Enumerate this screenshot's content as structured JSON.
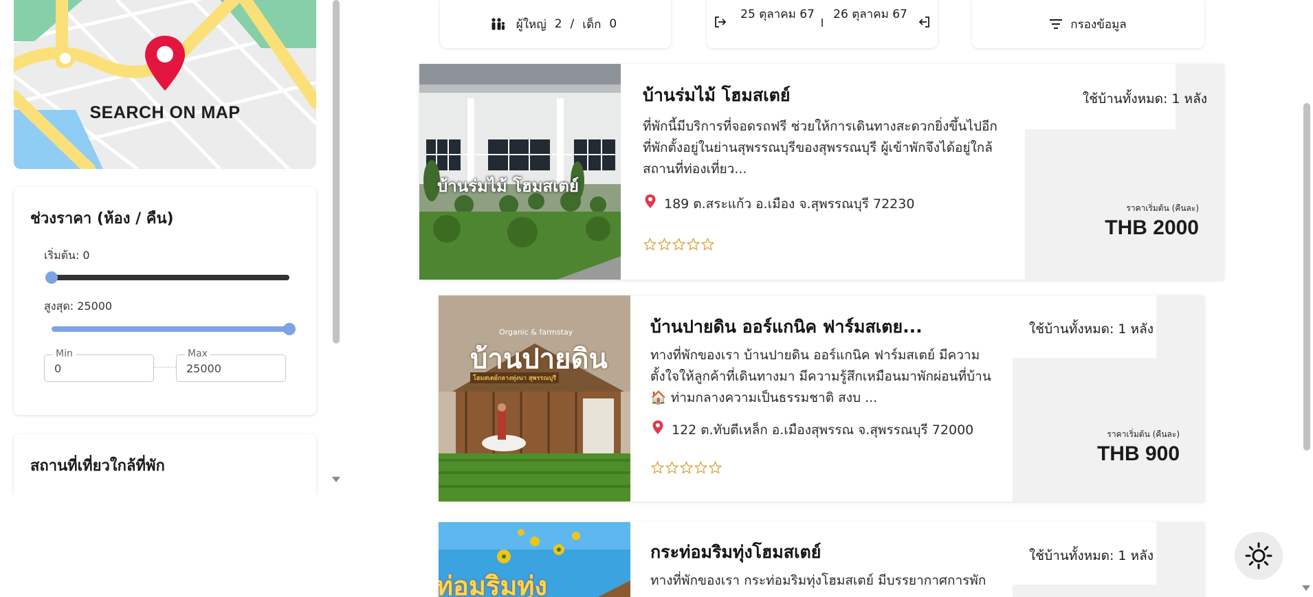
{
  "map": {
    "label": "SEARCH ON MAP",
    "icon": "map-pin-icon"
  },
  "price_filter": {
    "title": "ช่วงราคา (ห้อง / คืน)",
    "start_label": "เริ่มต้น: 0",
    "max_label": "สูงสุด: 25000",
    "min_slider_fraction": 0.0,
    "max_slider_fraction": 1.0,
    "min_field": {
      "legend": "Min",
      "value": "0"
    },
    "max_field": {
      "legend": "Max",
      "value": "25000"
    }
  },
  "nearby": {
    "title": "สถานที่เที่ยวใกล้ที่พัก"
  },
  "search_bar": {
    "guests": {
      "adults_label": "ผู้ใหญ่",
      "adults": "2",
      "separator": "/",
      "children_label": "เด็ก",
      "children": "0"
    },
    "dates": {
      "checkin": "25 ตุลาคม 67",
      "checkout": "26 ตุลาคม 67"
    },
    "filter_label": "กรองข้อมูล"
  },
  "listings": [
    {
      "title": "บ้านร่มไม้ โฮมสเตย์",
      "description": "ที่พักนี้มีบริการที่จอดรถฟรี ช่วยให้การเดินทางสะดวกยิ่งขึ้นไปอีก ที่พักตั้งอยู่ในย่านสุพรรณบุรีของสุพรรณบุรี ผู้เข้าพักจึงได้อยู่ใกล้สถานที่ท่องเที่ยว...",
      "address": "189 ต.สระแก้ว อ.เมือง จ.สุพรรณบุรี 72230",
      "capacity": "ใช้บ้านทั้งหมด: 1 หลัง",
      "price_label": "ราคาเริ่มต้น (คืนละ)",
      "price": "THB 2000",
      "rating": 0,
      "sign_text": "บ้านร่มไม้ โฮมสเตย์"
    },
    {
      "title": "บ้านปายดิน ออร์แกนิค ฟาร์มสเตย...",
      "description": "ทางที่พักของเรา บ้านปายดิน ออร์แกนิค ฟาร์มสเตย์ มีความตั้งใจให้ลูกค้าที่เดินทางมา มีความรู้สึกเหมือนมาพักผ่อนที่บ้าน 🏠 ท่ามกลางความเป็นธรรมชาติ สงบ ...",
      "address": "122 ต.ทับตีเหล็ก อ.เมืองสุพรรณ จ.สุพรรณบุรี 72000",
      "capacity": "ใช้บ้านทั้งหมด: 1 หลัง",
      "price_label": "ราคาเริ่มต้น (คืนละ)",
      "price": "THB 900",
      "rating": 0,
      "sign_small": "Organic & farmstay",
      "sign_big": "บ้านปายดิน",
      "sign_sub": "โฮมสเตย์กลางทุ่งนา สุพรรณบุรี"
    },
    {
      "title": "กระท่อมริมทุ่งโฮมสเตย์",
      "description": "ทางที่พักของเรา กระท่อมริมทุ่งโฮมสเตย์ มีบรรยากาศการพัก",
      "capacity": "ใช้บ้านทั้งหมด: 1 หลัง",
      "sign_text": "ท่อมริมทุ่ง"
    }
  ],
  "theme_toggle": {
    "icon": "sun-icon"
  },
  "colors": {
    "pin_red": "#e4163f",
    "star_gold": "#d9a441",
    "slider_blue": "#7ea3e3",
    "slider_dark": "#333333"
  }
}
